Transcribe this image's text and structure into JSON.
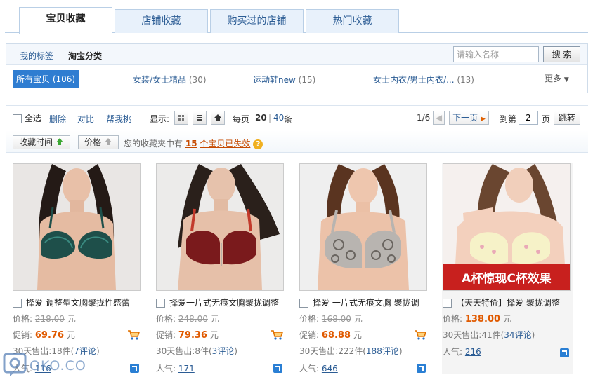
{
  "tabs": [
    {
      "label": "宝贝收藏",
      "active": true
    },
    {
      "label": "店铺收藏",
      "active": false
    },
    {
      "label": "购买过的店铺",
      "active": false
    },
    {
      "label": "热门收藏",
      "active": false
    }
  ],
  "subnav": {
    "my_tags": "我的标签",
    "taobao_cats": "淘宝分类"
  },
  "search": {
    "placeholder": "请输入名称",
    "button": "搜 索"
  },
  "categories": [
    {
      "name": "所有宝贝",
      "count": "(106)",
      "active": true
    },
    {
      "name": "女装/女士精品",
      "count": "(30)"
    },
    {
      "name": "运动鞋new",
      "count": "(15)"
    },
    {
      "name": "女士内衣/男士内衣/...",
      "count": "(13)"
    }
  ],
  "more_label": "更多",
  "toolbar": {
    "select_all": "全选",
    "delete": "删除",
    "compare": "对比",
    "help_pick": "帮我挑",
    "display": "显示:",
    "per_page": "每页",
    "per_page_20": "20",
    "sep": "|",
    "per_page_40": "40",
    "per_page_unit": "条",
    "page_info": "1/6",
    "next_page": "下一页",
    "goto": "到第",
    "page_value": "2",
    "page_unit": "页",
    "jump": "跳转"
  },
  "sort": {
    "by_time": "收藏时间",
    "by_price": "价格",
    "notice_prefix": "您的收藏夹中有",
    "invalid_count": "15",
    "notice_link": "个宝贝已失效"
  },
  "labels": {
    "price": "价格:",
    "promo": "促销:",
    "currency": "元",
    "sold_30": "30天售出:",
    "popularity": "人气:"
  },
  "products": [
    {
      "title": "择爱 调整型文胸聚拢性感蕾",
      "price": "218.00",
      "promo_price": "69.76",
      "sold": "18件",
      "comments": "7评论",
      "popularity": "116"
    },
    {
      "title": "择爱一片式无痕文胸聚拢调整",
      "price": "248.00",
      "promo_price": "79.36",
      "sold": "8件",
      "comments": "3评论",
      "popularity": "171"
    },
    {
      "title": "择爱 一片式无痕文胸 聚拢调",
      "price": "168.00",
      "promo_price": "68.88",
      "sold": "222件",
      "comments": "188评论",
      "popularity": "646"
    },
    {
      "title": "【天天特价】择爱 聚拢调整",
      "price": "138.00",
      "sold": "41件",
      "comments": "34评论",
      "popularity": "216",
      "banner": "A杯惊现C杯效果"
    }
  ],
  "watermark": "OKO.CO",
  "colors": {
    "accent": "#2f7dd1",
    "link": "#2b5c94",
    "promo": "#e05a00",
    "banner": "#c8201e"
  }
}
